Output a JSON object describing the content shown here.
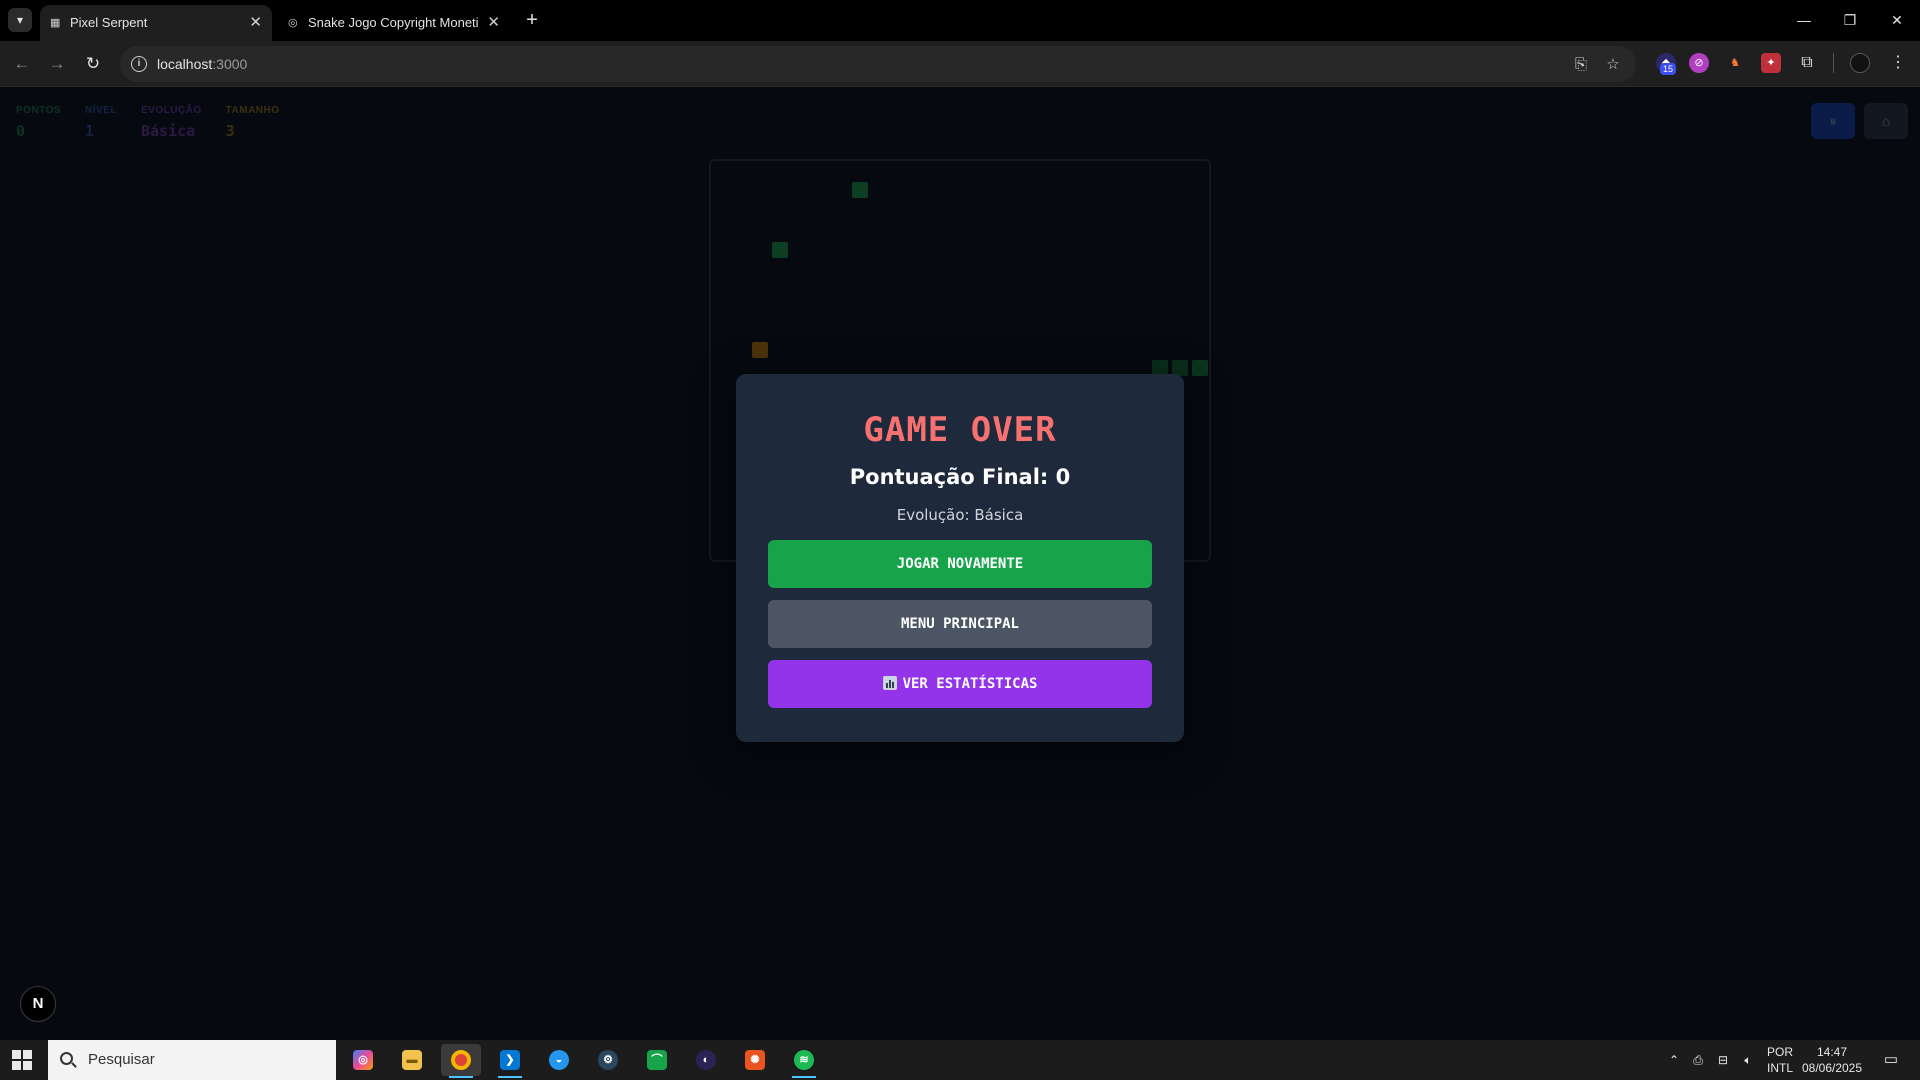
{
  "browser": {
    "tabs": [
      {
        "title": "Pixel Serpent",
        "active": true
      },
      {
        "title": "Snake Jogo Copyright Monetiza",
        "active": false
      }
    ],
    "url_host": "localhost",
    "url_port": ":3000",
    "extension_badge": "15"
  },
  "hud": {
    "stats": [
      {
        "label": "PONTOS",
        "value": "0",
        "color": "#22c55e"
      },
      {
        "label": "NÍVEL",
        "value": "1",
        "color": "#3b82f6"
      },
      {
        "label": "EVOLUÇÃO",
        "value": "Básica",
        "color": "#a855f7"
      },
      {
        "label": "TAMANHO",
        "value": "3",
        "color": "#eab308"
      }
    ],
    "pause_icon": "pause-icon",
    "home_icon": "home-icon"
  },
  "game": {
    "snake_color": "#15803d",
    "food_color": "#22c55e",
    "powerup_color": "#f59e0b"
  },
  "modal": {
    "title": "GAME OVER",
    "final_score": "Pontuação Final: 0",
    "evolution": "Evolução: Básica",
    "play_again": "JOGAR NOVAMENTE",
    "main_menu": "MENU PRINCIPAL",
    "stats": "VER ESTATÍSTICAS",
    "title_color": "#f87171",
    "play_color": "#16a34a",
    "menu_color": "#4b5563",
    "stats_color": "#9333ea"
  },
  "dev_badge": "N",
  "taskbar": {
    "search_placeholder": "Pesquisar",
    "lang_top": "POR",
    "lang_bottom": "INTL",
    "time": "14:47",
    "date": "08/06/2025"
  }
}
